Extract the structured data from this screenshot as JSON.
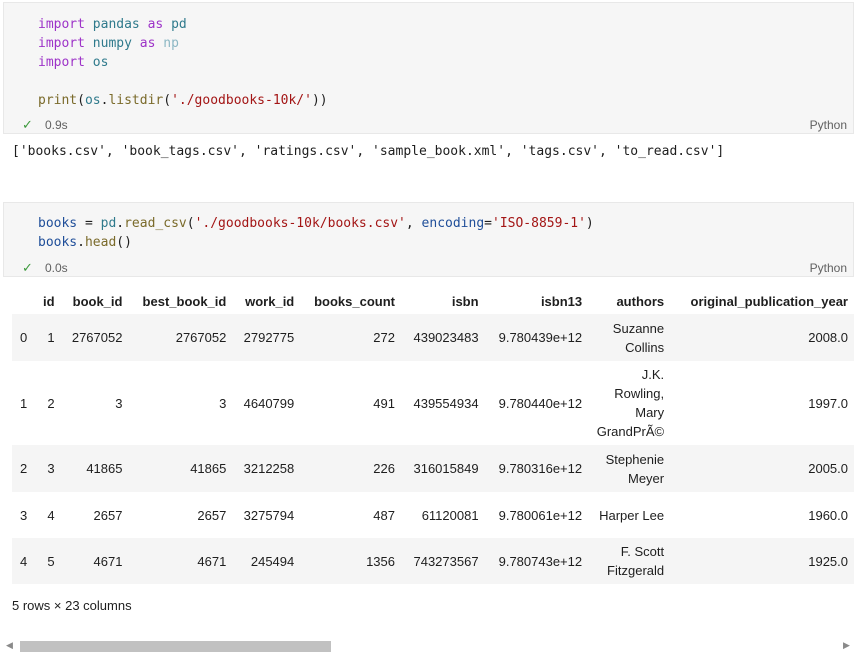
{
  "cell1": {
    "code_lines": [
      [
        {
          "t": "import",
          "c": "kw"
        },
        {
          "t": " pandas ",
          "c": "ns"
        },
        {
          "t": "as",
          "c": "kw"
        },
        {
          "t": " pd",
          "c": "ns"
        }
      ],
      [
        {
          "t": "import",
          "c": "kw"
        },
        {
          "t": " numpy ",
          "c": "ns"
        },
        {
          "t": "as",
          "c": "kw"
        },
        {
          "t": " np",
          "c": "faded"
        }
      ],
      [
        {
          "t": "import",
          "c": "kw"
        },
        {
          "t": " os",
          "c": "ns"
        }
      ],
      [],
      [
        {
          "t": "print",
          "c": "fn"
        },
        {
          "t": "(",
          "c": ""
        },
        {
          "t": "os",
          "c": "ns"
        },
        {
          "t": ".",
          "c": ""
        },
        {
          "t": "listdir",
          "c": "fn"
        },
        {
          "t": "(",
          "c": ""
        },
        {
          "t": "'./goodbooks-10k/'",
          "c": "str"
        },
        {
          "t": "))",
          "c": ""
        }
      ]
    ],
    "exec_time": "0.9s",
    "language": "Python"
  },
  "cell1_output": "['books.csv', 'book_tags.csv', 'ratings.csv', 'sample_book.xml', 'tags.csv', 'to_read.csv']",
  "cell2": {
    "code_lines": [
      [
        {
          "t": "books",
          "c": "var"
        },
        {
          "t": " = ",
          "c": ""
        },
        {
          "t": "pd",
          "c": "ns"
        },
        {
          "t": ".",
          "c": ""
        },
        {
          "t": "read_csv",
          "c": "fn"
        },
        {
          "t": "(",
          "c": ""
        },
        {
          "t": "'./goodbooks-10k/books.csv'",
          "c": "str"
        },
        {
          "t": ", ",
          "c": ""
        },
        {
          "t": "encoding",
          "c": "var"
        },
        {
          "t": "=",
          "c": ""
        },
        {
          "t": "'ISO-8859-1'",
          "c": "str"
        },
        {
          "t": ")",
          "c": ""
        }
      ],
      [
        {
          "t": "books",
          "c": "var"
        },
        {
          "t": ".",
          "c": ""
        },
        {
          "t": "head",
          "c": "fn"
        },
        {
          "t": "()",
          "c": ""
        }
      ]
    ],
    "exec_time": "0.0s",
    "language": "Python"
  },
  "dataframe": {
    "columns": [
      "",
      "id",
      "book_id",
      "best_book_id",
      "work_id",
      "books_count",
      "isbn",
      "isbn13",
      "authors",
      "original_publication_year"
    ],
    "rows": [
      [
        "0",
        "1",
        "2767052",
        "2767052",
        "2792775",
        "272",
        "439023483",
        "9.780439e+12",
        "Suzanne Collins",
        "2008.0"
      ],
      [
        "1",
        "2",
        "3",
        "3",
        "4640799",
        "491",
        "439554934",
        "9.780440e+12",
        "J.K. Rowling, Mary GrandPrÃ©",
        "1997.0"
      ],
      [
        "2",
        "3",
        "41865",
        "41865",
        "3212258",
        "226",
        "316015849",
        "9.780316e+12",
        "Stephenie Meyer",
        "2005.0"
      ],
      [
        "3",
        "4",
        "2657",
        "2657",
        "3275794",
        "487",
        "61120081",
        "9.780061e+12",
        "Harper Lee",
        "1960.0"
      ],
      [
        "4",
        "5",
        "4671",
        "4671",
        "245494",
        "1356",
        "743273567",
        "9.780743e+12",
        "F. Scott Fitzgerald",
        "1925.0"
      ]
    ],
    "row_info": "5 rows × 23 columns"
  },
  "colors": {
    "keyword": "#9d33c8",
    "string": "#a31515",
    "check": "#3d9a3d"
  },
  "icons": {
    "success": "check-icon",
    "scroll_left": "scroll-left-arrow-icon",
    "scroll_right": "scroll-right-arrow-icon"
  }
}
